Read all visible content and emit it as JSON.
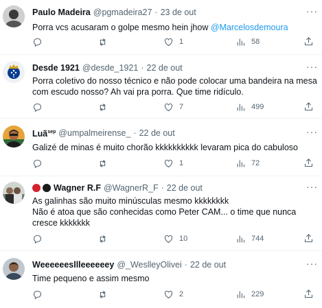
{
  "tweets": [
    {
      "name": "Paulo Madeira",
      "handle": "@pgmadeira27",
      "separator": "·",
      "date": "23 de out",
      "text_plain": "Porra vcs acusaram o golpe mesmo hein jhow ",
      "mention": "@Marcelosdemoura",
      "replies": "",
      "retweets": "",
      "likes": "1",
      "views": "58",
      "avatar": "user-avatar-icon"
    },
    {
      "name": "Desde 1921",
      "handle": "@desde_1921",
      "separator": "·",
      "date": "22 de out",
      "text_line1": "Porra coletivo do nosso técnico e não pode colocar uma bandeira na mesa",
      "text_line2": "com escudo nosso? Ah vai pra porra. Que time ridículo.",
      "replies": "",
      "retweets": "",
      "likes": "7",
      "views": "499",
      "avatar": "club-crest-icon"
    },
    {
      "name": "Luã",
      "name_sup": "sep",
      "handle": "@umpalmeirense_",
      "separator": "·",
      "date": "22 de out",
      "text": "Galizé de minas é muito chorão kkkkkkkkkk levaram pica do cabuloso",
      "replies": "",
      "retweets": "",
      "likes": "1",
      "views": "72",
      "avatar": "user-photo-avatar"
    },
    {
      "name": "Wagner R.F",
      "handle": "@WagnerR_F",
      "separator": "·",
      "date": "22 de out",
      "text_line1": "As galinhas são muito minúsculas mesmo kkkkkkkk",
      "text_line2": "Não é atoa que são conhecidas como Peter CAM... o time que nunca",
      "text_line3": "cresce kkkkkkk",
      "replies": "",
      "retweets": "",
      "likes": "10",
      "views": "744",
      "avatar": "user-photo-avatar"
    },
    {
      "name": "Weeeeeesllleeeeeey",
      "handle": "@_WeslleyOlivei",
      "separator": "·",
      "date": "22 de out",
      "text": "Time pequeno e assim mesmo",
      "replies": "",
      "retweets": "",
      "likes": "2",
      "views": "229",
      "avatar": "user-photo-avatar"
    }
  ],
  "more_label": "···"
}
